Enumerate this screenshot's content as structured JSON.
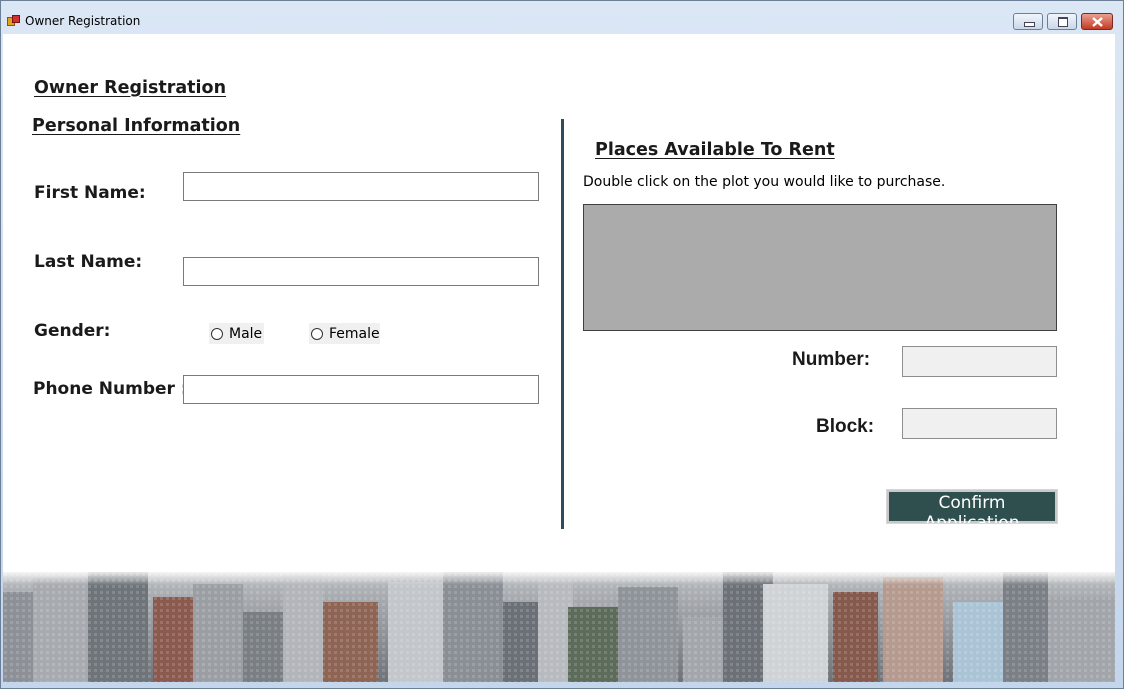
{
  "window": {
    "title": "Owner Registration",
    "icon": "app-form-icon",
    "controls": [
      "minimize-icon",
      "maximize-icon",
      "close-icon"
    ]
  },
  "form": {
    "heading": "Owner Registration",
    "personal_heading": "Personal Information",
    "first_name_label": "First Name:",
    "first_name_value": "",
    "last_name_label": "Last Name:",
    "last_name_value": "",
    "gender_label": "Gender:",
    "gender_options": [
      "Male",
      "Female"
    ],
    "gender_selected": null,
    "phone_label": "Phone Number :",
    "phone_value": ""
  },
  "places": {
    "heading": "Places Available To Rent",
    "instruction": "Double click on the plot you would like to purchase.",
    "number_label": "Number:",
    "number_value": "",
    "block_label": "Block:",
    "block_value": "",
    "confirm_label": "Confirm Application"
  },
  "colors": {
    "accent_button": "#2f4f4f",
    "divider": "#2e4d5e",
    "grid_background": "#ababab"
  }
}
